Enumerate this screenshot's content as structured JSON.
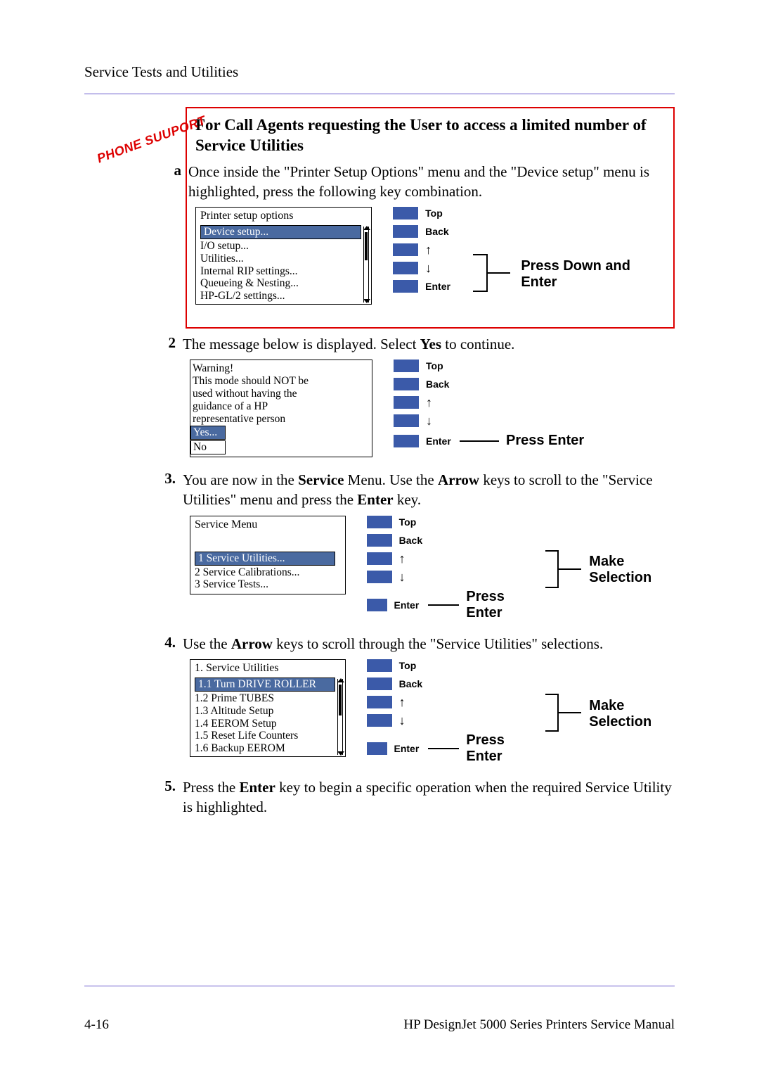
{
  "header": {
    "title": "Service Tests and Utilities"
  },
  "phone_support_label": "PHONE SUUPORT",
  "redbox": {
    "heading": "For Call Agents requesting the User to access a limited number of Service Utilities",
    "step_a_marker": "a",
    "step_a_text": "Once inside the \"Printer Setup Options\" menu and the \"Device setup\" menu is highlighted, press the following key combination.",
    "lcd": {
      "title": "Printer setup options",
      "highlight": "Device setup...",
      "lines": [
        "I/O setup...",
        "Utilities...",
        "Internal RIP settings...",
        "Queueing & Nesting...",
        "HP-GL/2 settings..."
      ]
    },
    "buttons": {
      "top": "Top",
      "back": "Back",
      "up": "↑",
      "down": "↓",
      "enter": "Enter"
    },
    "action": "Press Down and Enter"
  },
  "step2": {
    "marker": "2",
    "text_pre": "The message below is displayed. Select ",
    "text_bold": "Yes",
    "text_post": " to continue.",
    "lcd": {
      "lines": [
        "Warning!",
        "This mode should NOT be",
        "used without having the",
        "guidance of a HP",
        "representative person"
      ],
      "highlight": "Yes...",
      "last": "No"
    },
    "buttons": {
      "top": "Top",
      "back": "Back",
      "up": "↑",
      "down": "↓",
      "enter": "Enter"
    },
    "action": "Press Enter"
  },
  "step3": {
    "marker": "3.",
    "text_parts": [
      "You are now in the ",
      "Service",
      " Menu. Use the ",
      "Arrow",
      " keys to scroll to the \"Service Utilities\" menu and press the ",
      "Enter",
      " key."
    ],
    "lcd": {
      "title": "Service Menu",
      "highlight": "1 Service Utilities...",
      "lines": [
        "2 Service Calibrations...",
        "3 Service Tests..."
      ]
    },
    "buttons": {
      "top": "Top",
      "back": "Back",
      "up": "↑",
      "down": "↓",
      "enter": "Enter"
    },
    "action_sel": "Make Selection",
    "action_enter": "Press Enter"
  },
  "step4": {
    "marker": "4.",
    "text_parts": [
      "Use the ",
      "Arrow",
      " keys to scroll through the \"Service Utilities\" selections."
    ],
    "lcd": {
      "title": "1. Service Utilities",
      "highlight": "1.1 Turn DRIVE ROLLER",
      "lines": [
        "1.2 Prime TUBES",
        "1.3 Altitude Setup",
        "1.4 EEROM Setup",
        "1.5 Reset Life Counters",
        "1.6 Backup EEROM"
      ]
    },
    "buttons": {
      "top": "Top",
      "back": "Back",
      "up": "↑",
      "down": "↓",
      "enter": "Enter"
    },
    "action_sel": "Make Selection",
    "action_enter": "Press Enter"
  },
  "step5": {
    "marker": "5.",
    "text_parts": [
      "Press the ",
      "Enter",
      " key to begin a specific operation when the required Service Utility is highlighted."
    ]
  },
  "footer": {
    "page": "4-16",
    "doc": "HP DesignJet 5000 Series Printers Service Manual"
  }
}
